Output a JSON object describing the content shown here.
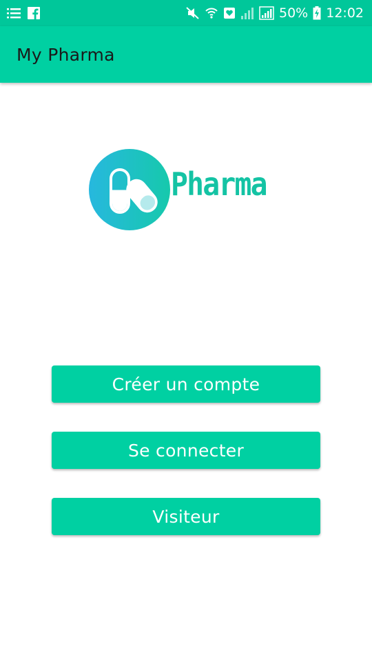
{
  "status_bar": {
    "icons_left": [
      "list-icon",
      "facebook-icon"
    ],
    "icons_right": [
      "muted-icon",
      "wifi-icon",
      "notification-icon",
      "signal-icon",
      "signal-full-icon",
      "battery-icon"
    ],
    "battery_percent": "50%",
    "time": "12:02"
  },
  "app_bar": {
    "title": "My Pharma"
  },
  "logo": {
    "icon": "pill-capsule-icon",
    "text": "Pharma"
  },
  "buttons": {
    "create_account": "Créer un compte",
    "login": "Se connecter",
    "visitor": "Visiteur"
  },
  "colors": {
    "accent": "#00d0a2",
    "status_bar": "#00c79a",
    "logo_text": "#14c3a4"
  }
}
